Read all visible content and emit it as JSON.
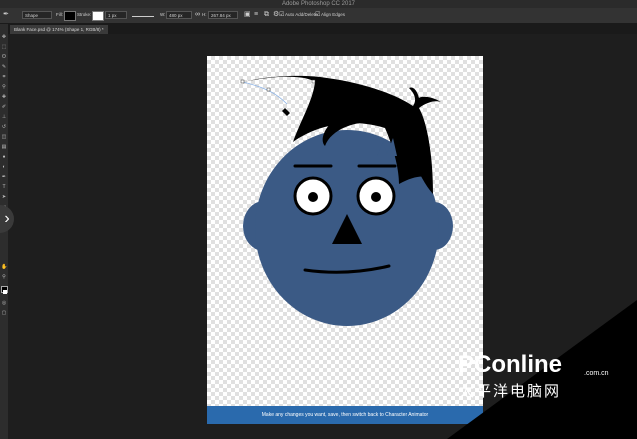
{
  "app": {
    "title": "Adobe Photoshop CC 2017"
  },
  "options_bar": {
    "tool_mode": "Shape",
    "fill_label": "Fill:",
    "stroke_label": "Stroke:",
    "stroke_size": "1 px",
    "w_label": "W:",
    "w_value": "480 px",
    "h_label": "H:",
    "h_value": "267.84 px",
    "auto_add_delete": "Auto Add/Delete",
    "align_edges": "Align Edges"
  },
  "document_tab": {
    "label": "Blank Face.psd @ 174% (Shape 1, RGB/8) *"
  },
  "caption": {
    "text": "Make any changes you want, save, then switch back to Character Animator"
  },
  "watermark": {
    "main": "PConline",
    "domain": ".com.cn",
    "sub": "太平洋电脑网"
  },
  "colors": {
    "face": "#3b5a85",
    "hair": "#000000",
    "caption_bg": "#2a6aad",
    "app_bg": "#1e1e1e"
  },
  "icons": [
    "pen-tool-icon",
    "move-icon",
    "marquee-icon",
    "lasso-icon",
    "crop-icon",
    "eyedropper-icon",
    "brush-icon",
    "eraser-icon",
    "gradient-icon",
    "text-icon",
    "hand-icon",
    "zoom-icon",
    "gear-icon",
    "chevron-right-icon"
  ]
}
